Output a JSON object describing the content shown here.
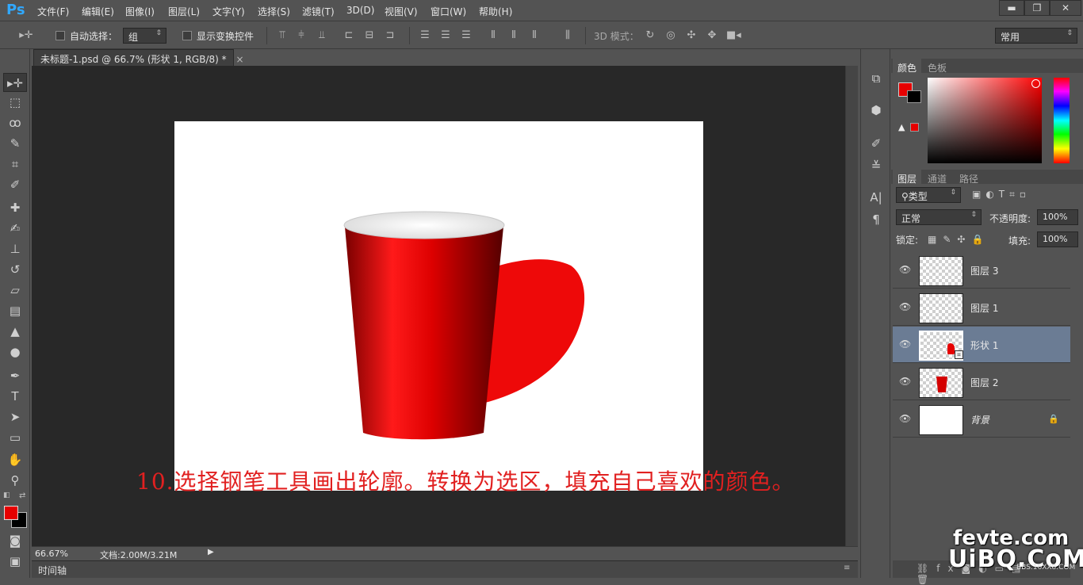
{
  "app": {
    "logo": "Ps"
  },
  "menu": [
    "文件(F)",
    "编辑(E)",
    "图像(I)",
    "图层(L)",
    "文字(Y)",
    "选择(S)",
    "滤镜(T)",
    "3D(D)",
    "视图(V)",
    "窗口(W)",
    "帮助(H)"
  ],
  "window_controls": {
    "minimize": "▬",
    "restore": "❐",
    "close": "✕"
  },
  "options": {
    "auto_select_label": "自动选择：",
    "auto_select_value": "组",
    "show_transform_label": "显示变换控件",
    "mode_3d_label": "3D 模式：",
    "workspace_value": "常用"
  },
  "document": {
    "tab_title": "未标题-1.psd @ 66.7% (形状 1, RGB/8) *",
    "close": "×"
  },
  "status": {
    "zoom": "66.67%",
    "doc_info": "文档:2.00M/3.21M",
    "timeline_label": "时间轴"
  },
  "color_panel": {
    "tabs": [
      "颜色",
      "色板"
    ],
    "foreground_color": "#e60000",
    "background_color": "#000000"
  },
  "layers_panel": {
    "tabs": [
      "图层",
      "通道",
      "路径"
    ],
    "filter_value": "类型",
    "blend_mode": "正常",
    "opacity_label": "不透明度:",
    "opacity_value": "100%",
    "lock_label": "锁定:",
    "fill_label": "填充:",
    "fill_value": "100%",
    "layers": [
      {
        "name": "图层 3",
        "selected": false,
        "locked": false
      },
      {
        "name": "图层 1",
        "selected": false,
        "locked": false
      },
      {
        "name": "形状 1",
        "selected": true,
        "locked": false
      },
      {
        "name": "图层 2",
        "selected": false,
        "locked": false
      },
      {
        "name": "背景",
        "selected": false,
        "locked": true
      }
    ]
  },
  "annotation": "10.选择钢笔工具画出轮廓。转换为选区，填充自己喜欢的颜色。",
  "watermark": {
    "line1": "fevte.com",
    "line2": "UiBQ.CoM",
    "line3": "BBS.16XX8.COM"
  }
}
